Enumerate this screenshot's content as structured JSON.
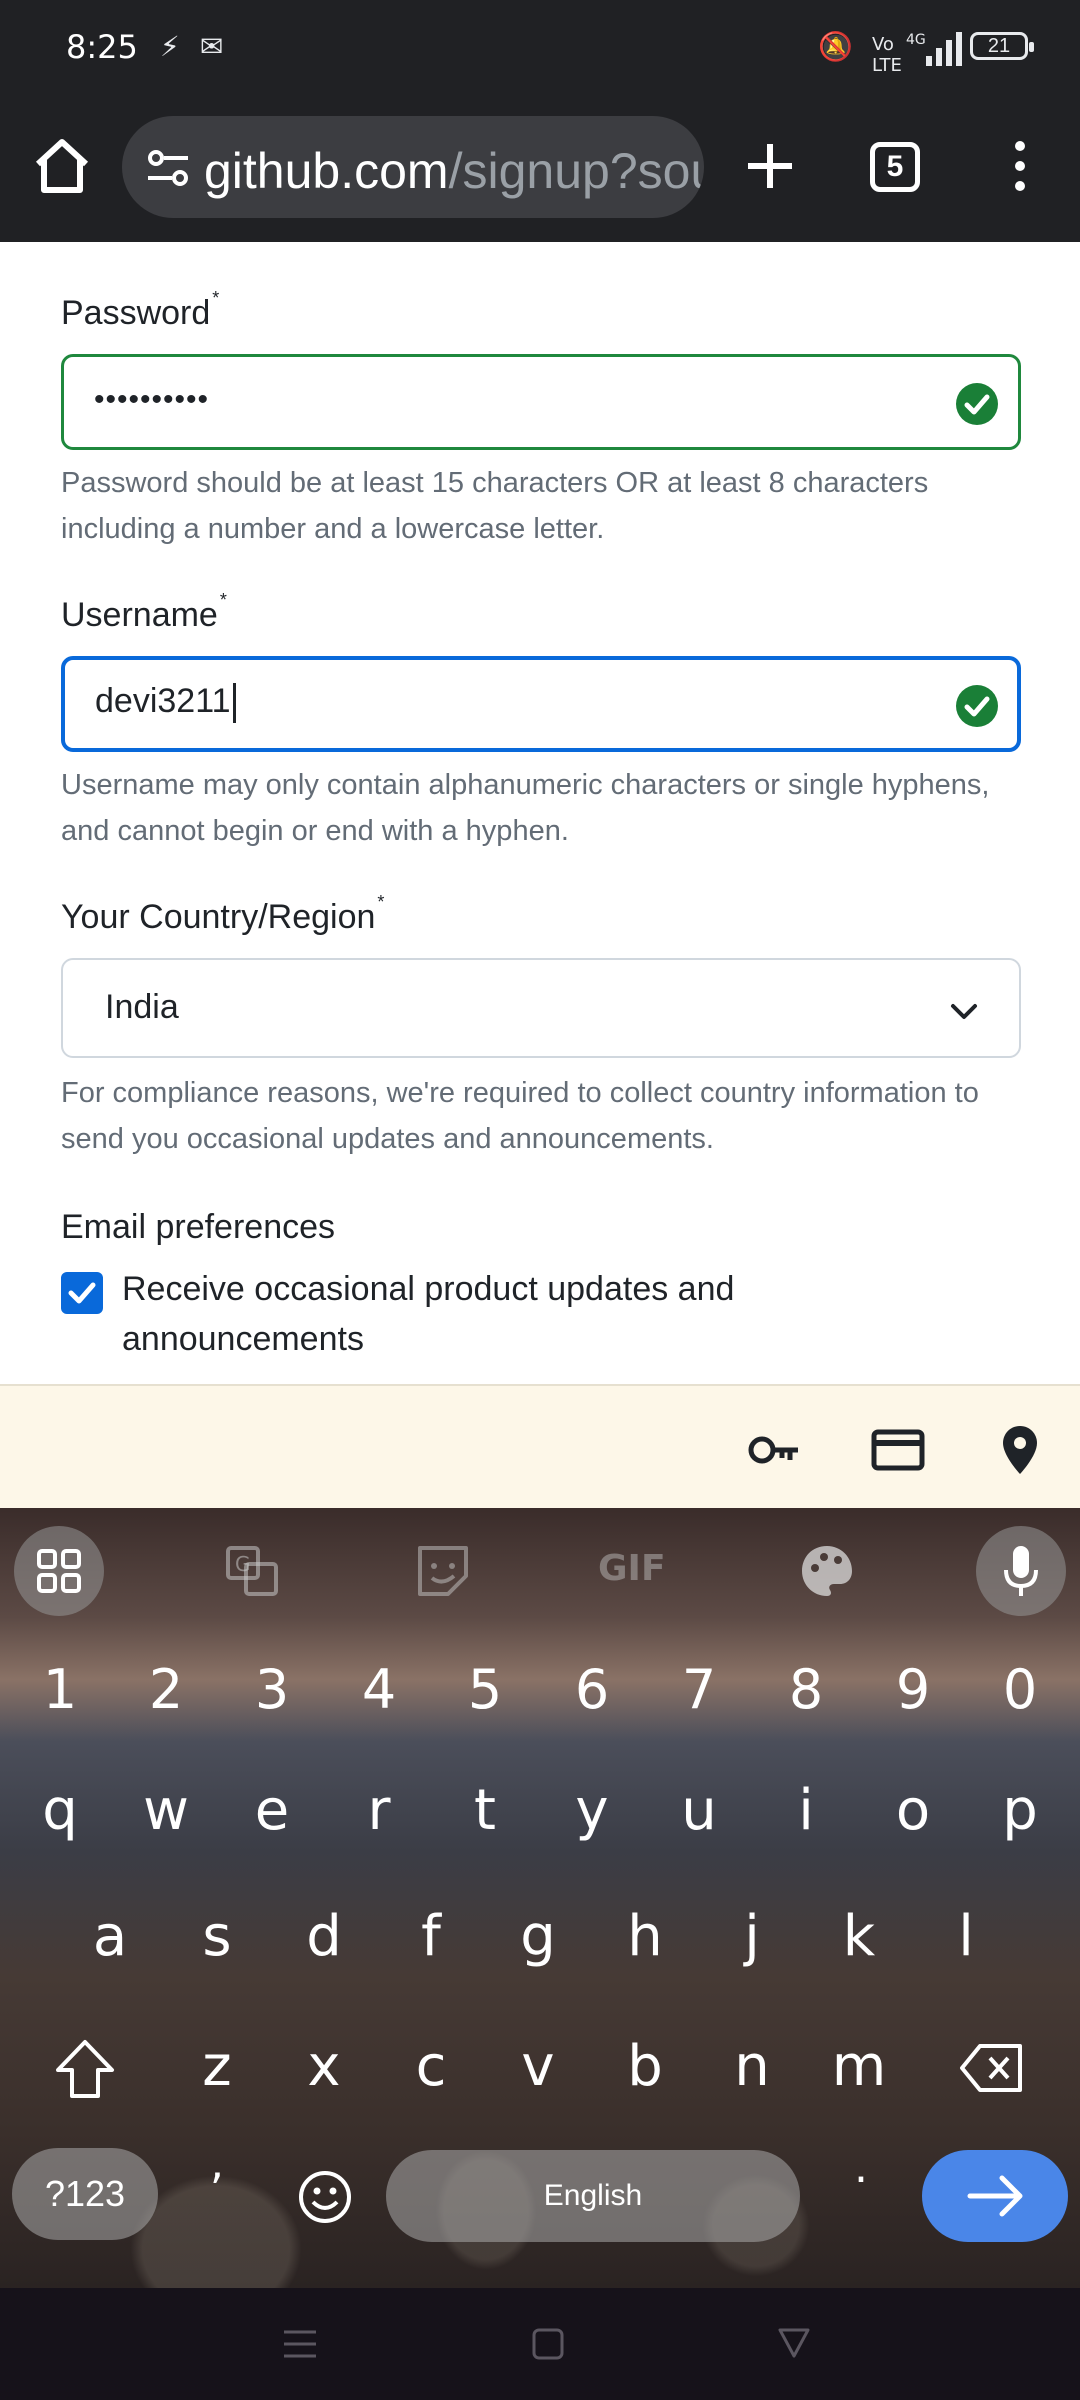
{
  "status_bar": {
    "time": "8:25",
    "battery": "21",
    "icons": [
      "flash-icon",
      "gmail-icon",
      "mute-icon",
      "volte-icon",
      "4g-signal-icon",
      "battery-icon"
    ]
  },
  "browser": {
    "url_domain": "github.com",
    "url_path": "/signup?sou",
    "tab_count": "5"
  },
  "form": {
    "password": {
      "label": "Password",
      "required_mark": "*",
      "value": "••••••••••",
      "hint": "Password should be at least 15 characters OR at least 8 characters including a number and a lowercase letter."
    },
    "username": {
      "label": "Username",
      "required_mark": "*",
      "value": "devi3211",
      "hint": "Username may only contain alphanumeric characters or single hyphens, and cannot begin or end with a hyphen."
    },
    "country": {
      "label": "Your Country/Region",
      "required_mark": "*",
      "value": "India",
      "hint": "For compliance reasons, we're required to collect country information to send you occasional updates and announcements."
    },
    "email_prefs": {
      "heading": "Email preferences",
      "checkbox_label": "Receive occasional product updates and announcements",
      "checked": true
    }
  },
  "keyboard": {
    "gif_label": "GIF",
    "numbers": [
      "1",
      "2",
      "3",
      "4",
      "5",
      "6",
      "7",
      "8",
      "9",
      "0"
    ],
    "row1": [
      "q",
      "w",
      "e",
      "r",
      "t",
      "y",
      "u",
      "i",
      "o",
      "p"
    ],
    "row2": [
      "a",
      "s",
      "d",
      "f",
      "g",
      "h",
      "j",
      "k",
      "l"
    ],
    "row3": [
      "z",
      "x",
      "c",
      "v",
      "b",
      "n",
      "m"
    ],
    "symbols_label": "?123",
    "comma": ",",
    "space_label": "English",
    "period": "."
  },
  "colors": {
    "success": "#1a7f37",
    "focus": "#0969da",
    "chrome_bg": "#202124",
    "enter_key": "#4a86e8"
  }
}
